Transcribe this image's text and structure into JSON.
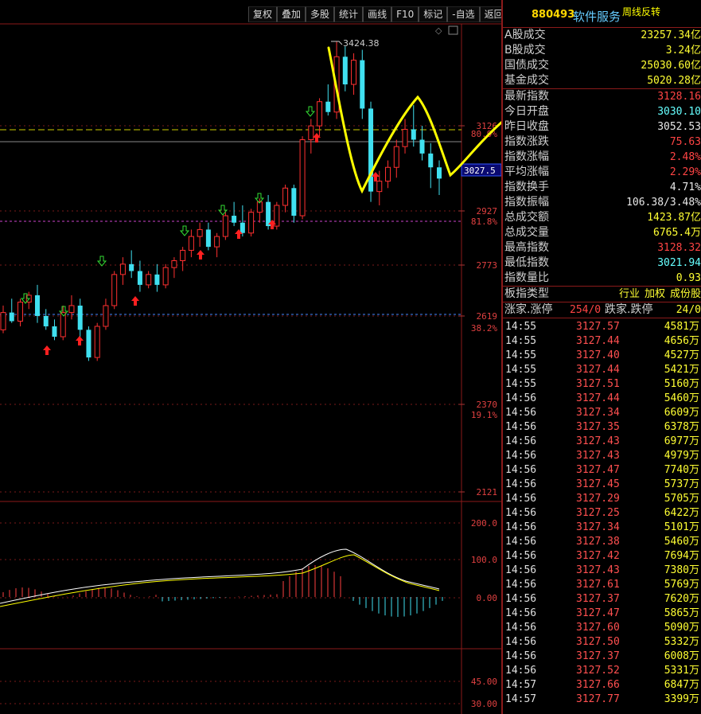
{
  "toolbar": {
    "buttons": [
      "复权",
      "叠加",
      "多股",
      "统计",
      "画线",
      "F10",
      "标记",
      "-自选",
      "返回"
    ]
  },
  "chart": {
    "price_labels": [
      "3126",
      "2927",
      "2773",
      "2619",
      "2370",
      "2121"
    ],
    "pct_labels": [
      "80.9%",
      "81.8%",
      "38.2%",
      "19.1%"
    ],
    "high_annotation": "3424.38",
    "current_tag": "3027.5",
    "macd_labels": [
      "200.0",
      "100.0",
      "0.00"
    ],
    "lower_labels": [
      "45.00",
      "30.00"
    ],
    "colors": {
      "up": "#ff3030",
      "down": "#40e0f0",
      "annotation": "#ffff00",
      "ma1": "#ffffff",
      "ma2": "#ffff00"
    }
  },
  "chart_data": {
    "type": "candlestick",
    "title": "",
    "candles": [
      [
        2590,
        2660,
        2580,
        2640
      ],
      [
        2640,
        2680,
        2610,
        2615
      ],
      [
        2615,
        2680,
        2600,
        2670
      ],
      [
        2670,
        2700,
        2650,
        2690
      ],
      [
        2690,
        2720,
        2610,
        2630
      ],
      [
        2630,
        2650,
        2590,
        2600
      ],
      [
        2600,
        2620,
        2560,
        2570
      ],
      [
        2570,
        2660,
        2560,
        2640
      ],
      [
        2640,
        2690,
        2620,
        2660
      ],
      [
        2660,
        2680,
        2570,
        2590
      ],
      [
        2590,
        2600,
        2500,
        2510
      ],
      [
        2510,
        2610,
        2500,
        2600
      ],
      [
        2600,
        2680,
        2590,
        2660
      ],
      [
        2660,
        2760,
        2650,
        2750
      ],
      [
        2750,
        2800,
        2720,
        2780
      ],
      [
        2780,
        2820,
        2740,
        2760
      ],
      [
        2760,
        2790,
        2700,
        2720
      ],
      [
        2720,
        2760,
        2710,
        2750
      ],
      [
        2750,
        2780,
        2700,
        2720
      ],
      [
        2720,
        2780,
        2710,
        2770
      ],
      [
        2770,
        2800,
        2740,
        2790
      ],
      [
        2790,
        2830,
        2760,
        2820
      ],
      [
        2820,
        2880,
        2800,
        2860
      ],
      [
        2860,
        2900,
        2830,
        2880
      ],
      [
        2880,
        2900,
        2820,
        2830
      ],
      [
        2830,
        2870,
        2800,
        2860
      ],
      [
        2860,
        2930,
        2850,
        2920
      ],
      [
        2920,
        2960,
        2890,
        2900
      ],
      [
        2900,
        2950,
        2860,
        2870
      ],
      [
        2870,
        2940,
        2860,
        2930
      ],
      [
        2930,
        2970,
        2900,
        2960
      ],
      [
        2960,
        2980,
        2880,
        2890
      ],
      [
        2890,
        2960,
        2880,
        2950
      ],
      [
        2950,
        3010,
        2930,
        3000
      ],
      [
        3000,
        3010,
        2900,
        2920
      ],
      [
        2920,
        3150,
        2910,
        3140
      ],
      [
        3140,
        3200,
        3100,
        3180
      ],
      [
        3180,
        3260,
        3150,
        3250
      ],
      [
        3250,
        3300,
        3210,
        3220
      ],
      [
        3220,
        3424,
        3200,
        3380
      ],
      [
        3380,
        3410,
        3280,
        3300
      ],
      [
        3300,
        3390,
        3270,
        3370
      ],
      [
        3370,
        3400,
        3200,
        3230
      ],
      [
        3230,
        3250,
        2960,
        2990
      ],
      [
        2990,
        3050,
        2950,
        3020
      ],
      [
        3020,
        3080,
        3000,
        3060
      ],
      [
        3060,
        3140,
        3030,
        3120
      ],
      [
        3120,
        3200,
        3100,
        3170
      ],
      [
        3170,
        3240,
        3120,
        3140
      ],
      [
        3140,
        3180,
        3080,
        3100
      ],
      [
        3100,
        3130,
        3000,
        3060
      ],
      [
        3060,
        3080,
        2980,
        3027.5
      ]
    ]
  },
  "panel": {
    "code": "880493",
    "name": "软件服务",
    "annotation": "周线反转",
    "stats": [
      {
        "label": "A股成交",
        "value": "23257.34",
        "unit": "亿",
        "color": "yel"
      },
      {
        "label": "B股成交",
        "value": "3.24",
        "unit": "亿",
        "color": "yel"
      },
      {
        "label": "国债成交",
        "value": "25030.60",
        "unit": "亿",
        "color": "yel"
      },
      {
        "label": "基金成交",
        "value": "5020.28",
        "unit": "亿",
        "color": "yel"
      },
      {
        "label": "最新指数",
        "value": "3128.16",
        "unit": "",
        "color": "red"
      },
      {
        "label": "今日开盘",
        "value": "3030.10",
        "unit": "",
        "color": "cyan"
      },
      {
        "label": "昨日收盘",
        "value": "3052.53",
        "unit": "",
        "color": "white"
      },
      {
        "label": "指数涨跌",
        "value": "75.63",
        "unit": "",
        "color": "red"
      },
      {
        "label": "指数涨幅",
        "value": "2.48%",
        "unit": "",
        "color": "red"
      },
      {
        "label": "平均涨幅",
        "value": "2.29%",
        "unit": "",
        "color": "red"
      },
      {
        "label": "指数换手",
        "value": "4.71%",
        "unit": "",
        "color": "white"
      },
      {
        "label": "指数振幅",
        "value": "106.38/3.48%",
        "unit": "",
        "color": "white"
      },
      {
        "label": "总成交额",
        "value": "1423.87",
        "unit": "亿",
        "color": "yel"
      },
      {
        "label": "总成交量",
        "value": "6765.4",
        "unit": "万",
        "color": "yel"
      },
      {
        "label": "最高指数",
        "value": "3128.32",
        "unit": "",
        "color": "red"
      },
      {
        "label": "最低指数",
        "value": "3021.94",
        "unit": "",
        "color": "cyan"
      },
      {
        "label": "指数量比",
        "value": "0.93",
        "unit": "",
        "color": "yel"
      }
    ],
    "board_type_label": "板指类型",
    "board_tags": [
      "行业",
      "加权",
      "成份股"
    ],
    "updown": {
      "up_label": "涨家.涨停",
      "up_value": "254/0",
      "down_label": "跌家.跌停",
      "down_value": "24/0"
    },
    "ticks": [
      {
        "t": "14:55",
        "p": "3127.57",
        "v": "4581",
        "u": "万"
      },
      {
        "t": "14:55",
        "p": "3127.44",
        "v": "4656",
        "u": "万"
      },
      {
        "t": "14:55",
        "p": "3127.40",
        "v": "4527",
        "u": "万"
      },
      {
        "t": "14:55",
        "p": "3127.44",
        "v": "5421",
        "u": "万"
      },
      {
        "t": "14:55",
        "p": "3127.51",
        "v": "5160",
        "u": "万"
      },
      {
        "t": "14:56",
        "p": "3127.44",
        "v": "5460",
        "u": "万"
      },
      {
        "t": "14:56",
        "p": "3127.34",
        "v": "6609",
        "u": "万"
      },
      {
        "t": "14:56",
        "p": "3127.35",
        "v": "6378",
        "u": "万"
      },
      {
        "t": "14:56",
        "p": "3127.43",
        "v": "6977",
        "u": "万"
      },
      {
        "t": "14:56",
        "p": "3127.43",
        "v": "4979",
        "u": "万"
      },
      {
        "t": "14:56",
        "p": "3127.47",
        "v": "7740",
        "u": "万"
      },
      {
        "t": "14:56",
        "p": "3127.45",
        "v": "5737",
        "u": "万"
      },
      {
        "t": "14:56",
        "p": "3127.29",
        "v": "5705",
        "u": "万"
      },
      {
        "t": "14:56",
        "p": "3127.25",
        "v": "6422",
        "u": "万"
      },
      {
        "t": "14:56",
        "p": "3127.34",
        "v": "5101",
        "u": "万"
      },
      {
        "t": "14:56",
        "p": "3127.38",
        "v": "5460",
        "u": "万"
      },
      {
        "t": "14:56",
        "p": "3127.42",
        "v": "7694",
        "u": "万"
      },
      {
        "t": "14:56",
        "p": "3127.43",
        "v": "7380",
        "u": "万"
      },
      {
        "t": "14:56",
        "p": "3127.61",
        "v": "5769",
        "u": "万"
      },
      {
        "t": "14:56",
        "p": "3127.37",
        "v": "7620",
        "u": "万"
      },
      {
        "t": "14:56",
        "p": "3127.47",
        "v": "5865",
        "u": "万"
      },
      {
        "t": "14:56",
        "p": "3127.60",
        "v": "5090",
        "u": "万"
      },
      {
        "t": "14:56",
        "p": "3127.50",
        "v": "5332",
        "u": "万"
      },
      {
        "t": "14:56",
        "p": "3127.37",
        "v": "6008",
        "u": "万"
      },
      {
        "t": "14:56",
        "p": "3127.52",
        "v": "5331",
        "u": "万"
      },
      {
        "t": "14:57",
        "p": "3127.66",
        "v": "6847",
        "u": "万"
      },
      {
        "t": "14:57",
        "p": "3127.77",
        "v": "3399",
        "u": "万"
      }
    ]
  }
}
